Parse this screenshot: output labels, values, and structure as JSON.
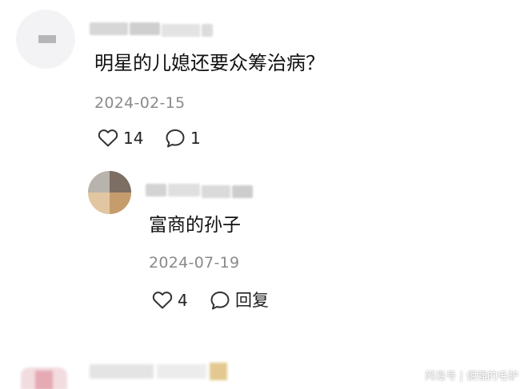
{
  "comment": {
    "text": "明星的儿媳还要众筹治病？",
    "date": "2024-02-15",
    "like_count": "14",
    "reply_count": "1"
  },
  "reply": {
    "text": "富商的孙子",
    "date": "2024-07-19",
    "like_count": "4",
    "reply_label": "回复"
  },
  "watermark": {
    "text": "网易号 | 倔强的毛驴"
  },
  "icons": {
    "like": "heart-outline-icon",
    "comment": "speech-bubble-icon"
  },
  "colors": {
    "text": "#111111",
    "meta": "#8a8a8a",
    "icon": "#333333"
  }
}
